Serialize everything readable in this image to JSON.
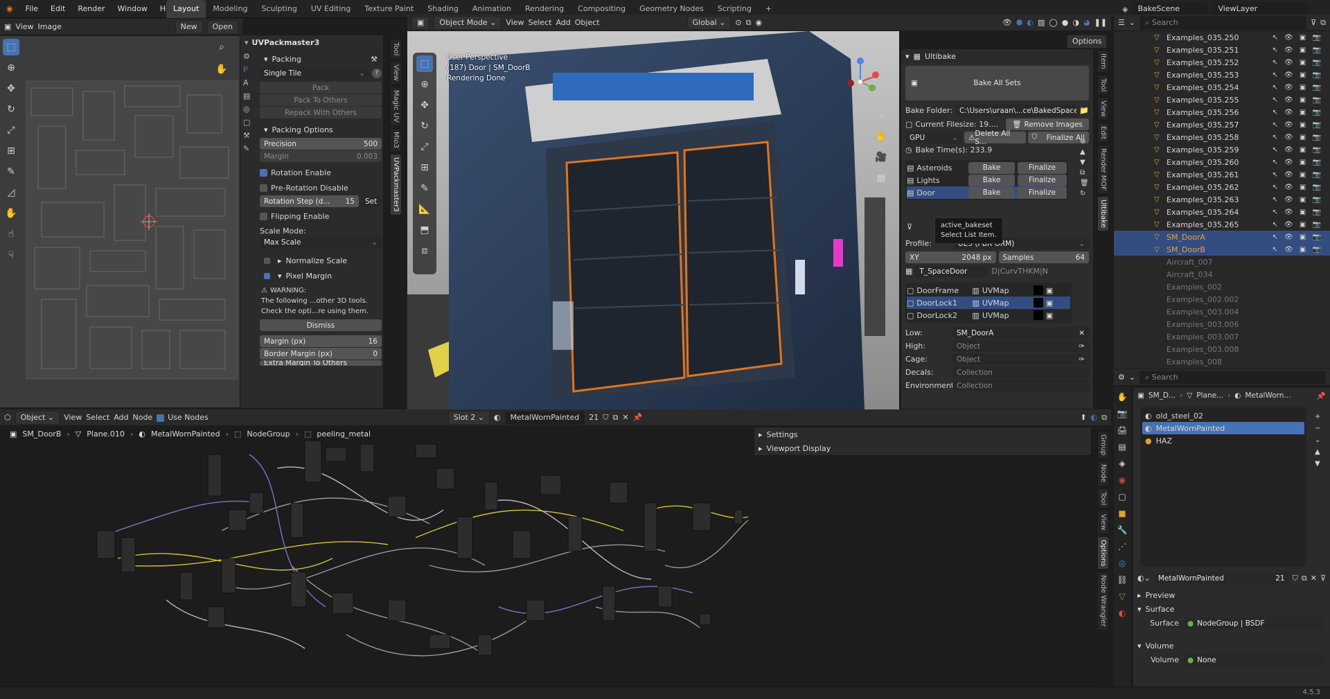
{
  "menu": [
    "File",
    "Edit",
    "Render",
    "Window",
    "Help"
  ],
  "workspaces": [
    "Layout",
    "Modeling",
    "Sculpting",
    "UV Editing",
    "Texture Paint",
    "Shading",
    "Animation",
    "Rendering",
    "Compositing",
    "Geometry Nodes",
    "Scripting"
  ],
  "scene_name": "BakeScene",
  "view_layer": "ViewLayer",
  "uv_editor": {
    "menus": [
      "View",
      "Image"
    ],
    "new": "New",
    "open": "Open"
  },
  "uvpack": {
    "title": "UVPackmaster3",
    "packing": "Packing",
    "single_tile": "Single Tile",
    "pack": "Pack",
    "pack_to_others": "Pack To Others",
    "repack_with_others": "Repack With Others",
    "packing_options": "Packing Options",
    "precision_label": "Precision",
    "precision_value": "500",
    "margin_label": "Margin",
    "margin_value": "0.003",
    "rotation_enable": "Rotation Enable",
    "pre_rotation_disable": "Pre-Rotation Disable",
    "rotation_step_label": "Rotation Step (d...",
    "rotation_step_value": "15",
    "set": "Set",
    "flipping_enable": "Flipping Enable",
    "scale_mode_label": "Scale Mode:",
    "scale_mode_value": "Max Scale",
    "normalize_scale": "Normalize Scale",
    "pixel_margin": "Pixel Margin",
    "warning_title": "WARNING:",
    "warning_line1": "The following ...other 3D tools.",
    "warning_line2": "Check the opti...re using them.",
    "dismiss": "Dismiss",
    "margin_px_label": "Margin (px)",
    "margin_px_value": "16",
    "border_margin_label": "Border Margin (px)",
    "border_margin_value": "0",
    "extra_margin": "Extra Margin To Others",
    "vtabs": [
      "Tool",
      "View",
      "Magic UV",
      "Mio3",
      "UVPackmaster3"
    ]
  },
  "viewport": {
    "mode": "Object Mode",
    "menus": [
      "View",
      "Select",
      "Add",
      "Object"
    ],
    "orientation": "Global",
    "options": "Options",
    "info1": "User Perspective",
    "info2": "(187) Door | SM_DoorB",
    "info3": "Rendering Done",
    "vtabs": [
      "Item",
      "Tool",
      "View",
      "Edit",
      "Render MOF",
      "Ultibake"
    ]
  },
  "ultibake": {
    "title": "Ultibake",
    "bake_all_sets": "Bake All Sets",
    "bake_folder_label": "Bake Folder:",
    "bake_folder_value": "C:\\Users\\uraan\\...ce\\BakedSpace\\",
    "current_filesize": "Current Filesize: 19....",
    "remove_images": "Remove Images",
    "device": "GPU",
    "delete_all": "Delete All S...",
    "finalize_all": "Finalize All",
    "bake_time": "Bake Time(s): 233.9",
    "sets": [
      {
        "name": "Asteroids",
        "bake": "Bake",
        "finalize": "Finalize"
      },
      {
        "name": "Lights",
        "bake": "Bake",
        "finalize": "Finalize"
      },
      {
        "name": "Door",
        "bake": "Bake",
        "finalize": "Finalize"
      }
    ],
    "tooltip_title": "active_bakeset",
    "tooltip_desc": "Select List Item.",
    "profile_label": "Profile:",
    "profile_value": "UE5 (PBR ORM)",
    "xy_label": "XY",
    "xy_value": "2048 px",
    "samples_label": "Samples",
    "samples_value": "64",
    "texture_name": "T_SpaceDoor",
    "texture_channels": "D|CurvTHKM|N",
    "objects": [
      {
        "name": "DoorFrame",
        "uv": "UVMap"
      },
      {
        "name": "DoorLock1",
        "uv": "UVMap"
      },
      {
        "name": "DoorLock2",
        "uv": "UVMap"
      }
    ],
    "low_label": "Low:",
    "low_value": "SM_DoorA",
    "high_label": "High:",
    "high_placeholder": "Object",
    "cage_label": "Cage:",
    "cage_placeholder": "Object",
    "decals_label": "Decals:",
    "decals_placeholder": "Collection",
    "env_label": "Environment:",
    "env_placeholder": "Collection"
  },
  "node_editor": {
    "type": "Object",
    "menus": [
      "View",
      "Select",
      "Add",
      "Node"
    ],
    "use_nodes": "Use Nodes",
    "slot": "Slot 2",
    "material": "MetalWornPainted",
    "users": "21",
    "breadcrumb": [
      "SM_DoorB",
      "Plane.010",
      "MetalWornPainted",
      "NodeGroup",
      "peeling_metal"
    ],
    "settings": "Settings",
    "viewport_display": "Viewport Display",
    "vtabs": [
      "Group",
      "Node",
      "Tool",
      "View",
      "Options",
      "Node Wrangler"
    ]
  },
  "outliner": {
    "search_placeholder": "Search",
    "items": [
      "Examples_035.250",
      "Examples_035.251",
      "Examples_035.252",
      "Examples_035.253",
      "Examples_035.254",
      "Examples_035.255",
      "Examples_035.256",
      "Examples_035.257",
      "Examples_035.258",
      "Examples_035.259",
      "Examples_035.260",
      "Examples_035.261",
      "Examples_035.262",
      "Examples_035.263",
      "Examples_035.264",
      "Examples_035.265"
    ],
    "selected": [
      "SM_DoorA",
      "SM_DoorB"
    ],
    "hidden": [
      "Aircraft_007",
      "Aircraft_034",
      "Examples_002",
      "Examples_002.002",
      "Examples_003.004",
      "Examples_003.006",
      "Examples_003.007",
      "Examples_003.008",
      "Examples_008"
    ]
  },
  "properties": {
    "search_placeholder": "Search",
    "breadcrumb": [
      "SM_D...",
      "Plane...",
      "MetalWorn..."
    ],
    "materials": [
      "old_steel_02",
      "MetalWornPainted",
      "HAZ"
    ],
    "material_name": "MetalWornPainted",
    "users": "21",
    "preview": "Preview",
    "surface": "Surface",
    "surface_label": "Surface",
    "surface_value": "NodeGroup | BSDF",
    "volume": "Volume",
    "volume_label": "Volume",
    "volume_value": "None"
  },
  "version": "4.5.3",
  "colors": {
    "accent": "#4772b3",
    "selection": "#334d80",
    "orange": "#e0a02c"
  }
}
